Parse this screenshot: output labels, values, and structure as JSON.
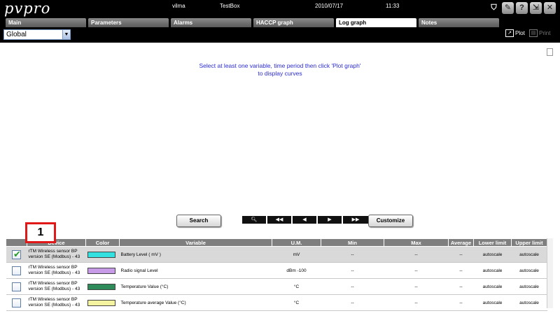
{
  "app": {
    "logo": "pvpro",
    "user": "vilma",
    "site": "TestBox",
    "date": "2010/07/17",
    "time": "11:33"
  },
  "tabs": [
    {
      "label": "Main",
      "active": false
    },
    {
      "label": "Parameters",
      "active": false
    },
    {
      "label": "Alarms",
      "active": false
    },
    {
      "label": "HACCP graph",
      "active": false
    },
    {
      "label": "Log graph",
      "active": true
    },
    {
      "label": "Notes",
      "active": false
    }
  ],
  "toolbar": {
    "scope_select": "Global",
    "plot_label": "Plot",
    "print_label": "Print"
  },
  "graph": {
    "message_line1": "Select at least one variable, time period then click 'Plot graph'",
    "message_line2": "to display curves"
  },
  "controls": {
    "search_label": "Search",
    "customize_label": "Customize"
  },
  "callout": {
    "number": "1"
  },
  "table": {
    "headers": {
      "device": "Device",
      "color": "Color",
      "variable": "Variable",
      "um": "U.M.",
      "min": "Min",
      "max": "Max",
      "average": "Average",
      "lower": "Lower limit",
      "upper": "Upper limit"
    },
    "rows": [
      {
        "checked": true,
        "device1": "rTM Wireless sensor BP",
        "device2": "version SE (Modbus) - 43",
        "color": "#33e0e0",
        "variable": "Battery Level ( mV )",
        "um": "mV",
        "min": "--",
        "max": "--",
        "average": "--",
        "lower": "autoscale",
        "upper": "autoscale"
      },
      {
        "checked": false,
        "device1": "rTM Wireless sensor BP",
        "device2": "version SE (Modbus) - 43",
        "color": "#c79be8",
        "variable": "Radio signal Level",
        "um": "dBm -100",
        "min": "--",
        "max": "--",
        "average": "--",
        "lower": "autoscale",
        "upper": "autoscale"
      },
      {
        "checked": false,
        "device1": "rTM Wireless sensor BP",
        "device2": "version SE (Modbus) - 43",
        "color": "#2e8a58",
        "variable": "Temperature Value (°C)",
        "um": "°C",
        "min": "--",
        "max": "--",
        "average": "--",
        "lower": "autoscale",
        "upper": "autoscale"
      },
      {
        "checked": false,
        "device1": "rTM Wireless sensor BP",
        "device2": "version SE (Modbus) - 43",
        "color": "#f3f3a0",
        "variable": "Temperature average Value (°C)",
        "um": "°C",
        "min": "--",
        "max": "--",
        "average": "--",
        "lower": "autoscale",
        "upper": "autoscale"
      }
    ]
  }
}
